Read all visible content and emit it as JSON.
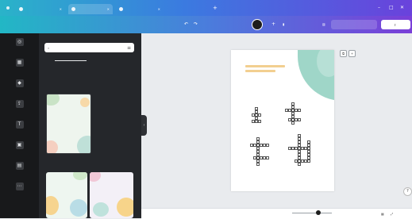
{
  "browser": {
    "tabs": [
      {
        "label": "",
        "active": false
      },
      {
        "label": "",
        "active": true
      },
      {
        "label": "",
        "active": false
      }
    ],
    "new_tab_icon": "+",
    "window_controls": [
      "–",
      "□",
      "✕"
    ]
  },
  "toolbar": {
    "home_label": "",
    "file_label": "",
    "resize_label": "",
    "doc_name": "",
    "undo_icon": "↶",
    "redo_icon": "↷",
    "save_label": "",
    "analytics_label": "",
    "present_label": "",
    "share_label": ""
  },
  "rail": {
    "items": [
      {
        "icon": "apps-icon",
        "glyph": "◎",
        "label": ""
      },
      {
        "icon": "templates-icon",
        "glyph": "▦",
        "label": ""
      },
      {
        "icon": "elements-icon",
        "glyph": "◆",
        "label": ""
      },
      {
        "icon": "uploads-icon",
        "glyph": "⇪",
        "label": ""
      },
      {
        "icon": "text-icon",
        "glyph": "T",
        "label": ""
      },
      {
        "icon": "photos-icon",
        "glyph": "▣",
        "label": ""
      },
      {
        "icon": "projects-icon",
        "glyph": "▤",
        "label": ""
      },
      {
        "icon": "more-icon",
        "glyph": "⋯",
        "label": ""
      }
    ]
  },
  "panel": {
    "search": {
      "placeholder": "",
      "value": ""
    },
    "tabs": [
      "",
      ""
    ],
    "chips": [
      "",
      "",
      "",
      ""
    ],
    "section_1": {
      "title": "",
      "thumbnail_heading": ""
    },
    "section_2": {
      "title": "",
      "thumbnail_headings": [
        "",
        ""
      ]
    }
  },
  "canvas": {
    "page_label": "",
    "accent_color": "#9fd6c8",
    "title_color": "#f2cf90"
  },
  "bottombar": {
    "notes_label": "",
    "page_counter": "",
    "zoom_value": "",
    "help_icon": "?"
  },
  "colors": {
    "tabbar_start": "#2ab3c9",
    "tabbar_end": "#6a42dc",
    "rail_bg": "#18191b",
    "panel_bg": "#25272b"
  }
}
